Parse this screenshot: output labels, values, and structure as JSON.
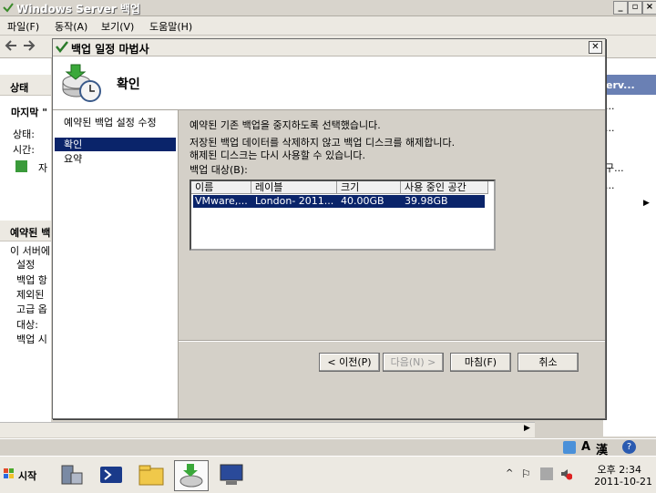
{
  "window": {
    "title": "Windows Server 백업"
  },
  "menu": [
    "파일(F)",
    "동작(A)",
    "보기(V)",
    "도움말(H)"
  ],
  "left_panel": {
    "status_heading": "상태",
    "last_label": "마지막 \"",
    "status_label": "상태:",
    "time_label": "시간:",
    "link_fragment": "자",
    "scheduled_heading": "예약된 백",
    "server_text": "이 서버에",
    "settings_group": "설정",
    "backup_items": "백업 항",
    "excluded": "제외된",
    "advanced": "고급 옵",
    "target": "대상:",
    "backup_time": "백업 시"
  },
  "right_panel": {
    "action_title": "erv...",
    "item1": "...",
    "item2": "...",
    "item3": "구...",
    "item4": "..."
  },
  "dialog": {
    "title": "백업 일정 마법사",
    "header": "확인",
    "nav": [
      "예약된 백업 설정 수정",
      "확인",
      "요약"
    ],
    "nav_selected_index": 1,
    "msg1": "예약된 기존 백업을 중지하도록 선택했습니다.",
    "msg2": "저장된 백업 데이터를 삭제하지 않고 백업 디스크를 해제합니다.",
    "msg3": "해제된 디스크는 다시 사용할 수 있습니다.",
    "list_label": "백업 대상(B):",
    "columns": [
      "이름",
      "레이블",
      "크기",
      "사용 중인 공간"
    ],
    "rows": [
      {
        "name": "VMware,...",
        "label": "London- 2011...",
        "size": "40.00GB",
        "used": "39.98GB"
      }
    ],
    "buttons": {
      "back": "< 이전(P)",
      "next": "다음(N) >",
      "finish": "마침(F)",
      "cancel": "취소"
    }
  },
  "tray": {
    "ime_lang": "A",
    "ime_mode": "漢"
  },
  "taskbar": {
    "start": "시작",
    "time": "오후 2:34",
    "date": "2011-10-21"
  }
}
